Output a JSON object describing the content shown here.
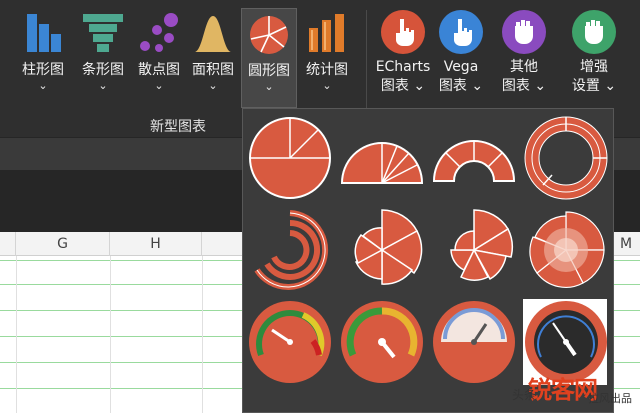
{
  "ribbon": {
    "buttons": [
      {
        "label": "柱形图",
        "icon": "column-chart-icon"
      },
      {
        "label": "条形图",
        "icon": "funnel-bar-chart-icon"
      },
      {
        "label": "散点图",
        "icon": "scatter-chart-icon"
      },
      {
        "label": "面积图",
        "icon": "area-chart-icon"
      },
      {
        "label": "圆形图",
        "icon": "pie-chart-icon",
        "active": true
      },
      {
        "label": "统计图",
        "icon": "statistic-chart-icon"
      }
    ],
    "group_label": "新型图表",
    "extra_buttons": [
      {
        "line1": "ECharts",
        "line2": "图表",
        "icon": "hand-point-icon",
        "color": "#d6543a"
      },
      {
        "line1": "Vega",
        "line2": "图表",
        "icon": "hand-point-icon",
        "color": "#3a84d6"
      },
      {
        "line1": "其他",
        "line2": "图表",
        "icon": "fist-icon",
        "color": "#8a4bbf"
      },
      {
        "line1": "增强",
        "line2": "设置",
        "icon": "fist-icon",
        "color": "#3ea36a"
      }
    ],
    "chevron": "⌄",
    "chevron_inline": "⌄"
  },
  "sheet": {
    "columns": [
      "G",
      "H",
      "M"
    ]
  },
  "dropdown": {
    "items": [
      {
        "name": "pie-basic"
      },
      {
        "name": "pie-semicircle"
      },
      {
        "name": "pie-half-donut"
      },
      {
        "name": "donut-multi"
      },
      {
        "name": "radial-bar"
      },
      {
        "name": "rose-pie"
      },
      {
        "name": "rose-pie-2"
      },
      {
        "name": "rose-pie-3"
      },
      {
        "name": "gauge-1"
      },
      {
        "name": "gauge-2"
      },
      {
        "name": "gauge-3"
      },
      {
        "name": "gauge-4"
      }
    ]
  },
  "watermark": {
    "main": "锐客网",
    "sub": "头条",
    "sub2": "拉风出品"
  },
  "colors": {
    "accent": "#d85a40",
    "ribbon_bg": "#2f2f2f",
    "dropdown_bg": "#3b3b3b",
    "grid_green": "#55c25b"
  }
}
